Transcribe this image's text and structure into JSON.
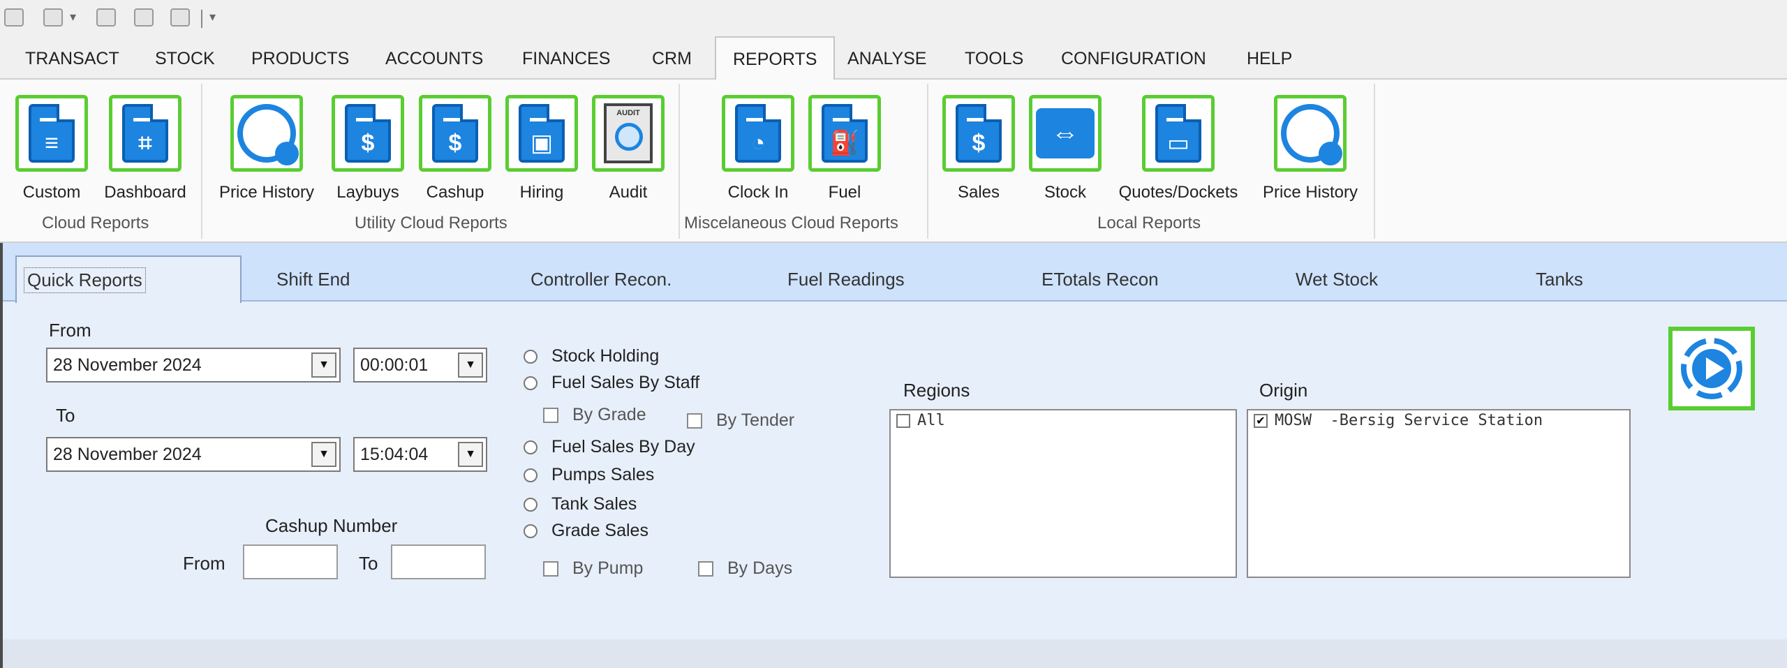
{
  "menu_tabs": [
    "TRANSACT",
    "STOCK",
    "PRODUCTS",
    "ACCOUNTS",
    "FINANCES",
    "CRM",
    "REPORTS",
    "ANALYSE",
    "TOOLS",
    "CONFIGURATION",
    "HELP"
  ],
  "active_menu_tab": "REPORTS",
  "ribbon": {
    "groups": [
      {
        "label": "Cloud Reports",
        "buttons": [
          "Custom",
          "Dashboard"
        ]
      },
      {
        "label": "Utility Cloud Reports",
        "buttons": [
          "Price History",
          "Laybuys",
          "Cashup",
          "Hiring",
          "Audit"
        ]
      },
      {
        "label": "Miscelaneous Cloud Reports",
        "buttons": [
          "Clock In",
          "Fuel"
        ]
      },
      {
        "label": "Local Reports",
        "buttons": [
          "Sales",
          "Stock",
          "Quotes/Dockets",
          "Price History"
        ]
      }
    ],
    "audit_icon_text": "AUDIT",
    "dollar_glyph": "$"
  },
  "content_tabs": [
    "Quick Reports",
    "Shift End",
    "Controller Recon.",
    "Fuel Readings",
    "ETotals Recon",
    "Wet Stock",
    "Tanks"
  ],
  "active_content_tab": "Quick Reports",
  "form": {
    "from_label": "From",
    "from_date": "28 November 2024",
    "from_time": "00:00:01",
    "to_label": "To",
    "to_date": "28 November 2024",
    "to_time": "15:04:04",
    "cashup_number_label": "Cashup Number",
    "cashup_from_label": "From",
    "cashup_to_label": "To",
    "cashup_from_value": "",
    "cashup_to_value": ""
  },
  "report_options": {
    "stock_holding": "Stock Holding",
    "fuel_sales_by_staff": "Fuel Sales By Staff",
    "by_grade": "By Grade",
    "by_tender": "By Tender",
    "fuel_sales_by_day": "Fuel Sales By Day",
    "pumps_sales": "Pumps Sales",
    "tank_sales": "Tank Sales",
    "grade_sales": "Grade Sales",
    "by_pump": "By Pump",
    "by_days": "By Days"
  },
  "regions": {
    "label": "Regions",
    "items": [
      {
        "text": "All",
        "checked": false
      }
    ]
  },
  "origin": {
    "label": "Origin",
    "items": [
      {
        "text": "MOSW  -Bersig Service Station",
        "checked": true
      }
    ]
  },
  "check_glyph": "✔",
  "combo_arrow_glyph": "▼",
  "colors": {
    "ribbon_green": "#5acd32",
    "icon_blue": "#1d84e0",
    "tab_blue": "#cee2fc"
  }
}
